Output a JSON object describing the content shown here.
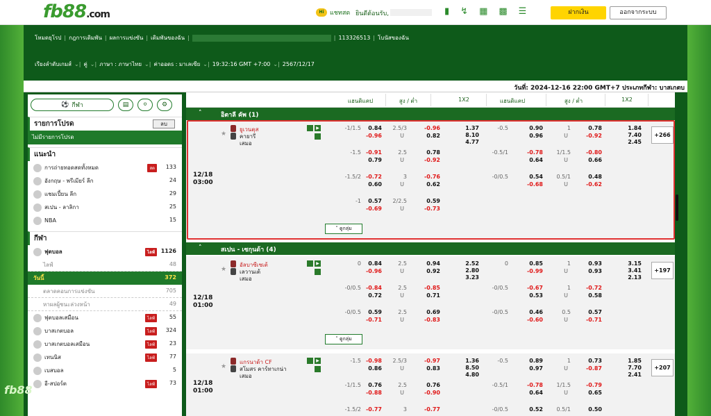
{
  "brand": {
    "logo_main": "fb88",
    "logo_suffix": ".com",
    "watermark": "fb88"
  },
  "topbar": {
    "chat_badge": "Hi",
    "chat_label": "แชทสด",
    "welcome": "ยินดีต้อนรับ,",
    "deposit_label": "ฝากเงิน",
    "logout_label": "ออกจากระบบ"
  },
  "nav1": {
    "items": [
      "โหมดยุโรป",
      "กฎการเดิมพัน",
      "ผลการแข่งขัน",
      "เดิมพันของฉัน"
    ],
    "account_no": "113326513",
    "bonus": "โบนัสของฉัน"
  },
  "nav2": {
    "odds_order": "เรียงลำดับเกมส์",
    "pair": "คู่",
    "language": "ภาษา : ภาษาไทย",
    "odds_type": "ค่าออดs : มาเลเซีย",
    "clock": "19:32:16 GMT +7:00",
    "date": "2567/12/17"
  },
  "datebar": {
    "text": "วันที่: 2024-12-16 22:00 GMT+7 ประเภทกีฬา: บาสเกตบ"
  },
  "sidebar": {
    "sports_pill": "กีฬา",
    "favorites_title": "รายการโปรด",
    "favorites_btn": "ลบ",
    "favorites_empty": "ไม่มีรายการโปรด",
    "recommend_title": "แนะนำ",
    "recommend": [
      {
        "label": "การถ่ายทอดสดทั้งหมด",
        "live": "สด",
        "count": "133"
      },
      {
        "label": "อังกฤษ - พรีเมียร์ ลีก",
        "count": "24"
      },
      {
        "label": "แชมเปี้ยน ลีก",
        "count": "29"
      },
      {
        "label": "สเปน - ลาลิกา",
        "count": "25"
      },
      {
        "label": "NBA",
        "count": "15"
      }
    ],
    "sports_title": "กีฬา",
    "sports": [
      {
        "label": "ฟุตบอล",
        "live": "ไลฟ์",
        "count": "1126",
        "type": "bold"
      },
      {
        "label": "ไลฟ์",
        "count": "48",
        "type": "sub"
      },
      {
        "label": "วันนี้",
        "count": "372",
        "type": "active"
      },
      {
        "label": "ตลาดคอนการแข่งขัน",
        "count": "705",
        "type": "sub"
      },
      {
        "label": "หาผลผู้ชนะล่วงหน้า",
        "count": "49",
        "type": "sub"
      },
      {
        "label": "ฟุตบอลเสมือน",
        "live": "ไลฟ์",
        "count": "55",
        "type": "normal"
      },
      {
        "label": "บาสเกตบอล",
        "live": "ไลฟ์",
        "count": "324",
        "type": "normal"
      },
      {
        "label": "บาสเกตบอลเสมือน",
        "live": "ไลฟ์",
        "count": "23",
        "type": "normal"
      },
      {
        "label": "เทนนิส",
        "live": "ไลฟ์",
        "count": "77",
        "type": "normal"
      },
      {
        "label": "เบสบอล",
        "count": "5",
        "type": "normal"
      },
      {
        "label": "อี-สปอร์ต",
        "live": "ไลฟ์",
        "count": "73",
        "type": "normal"
      }
    ]
  },
  "columns": [
    "แฮนดิแคป",
    "สูง / ต่ำ",
    "1X2",
    "แฮนดิแคป",
    "สูง / ต่ำ",
    "1X2"
  ],
  "leagues": [
    {
      "name": "อิตาลี คัพ (1)"
    },
    {
      "name": "สเปน - เซกุนด้า (4)"
    }
  ],
  "expand_label": "ดูกลุ่ม",
  "matches": [
    {
      "date": "12/18",
      "time": "03:00",
      "home": "ยูเวนตุส",
      "away": "คายารี",
      "draw": "เสมอ",
      "more": "+266",
      "lines": [
        {
          "hdp": "-1/1.5",
          "h1": "0.84",
          "h2": "-0.96",
          "ou": "2.5/3",
          "ou2": "U",
          "o1": "-0.96",
          "o2": "0.82",
          "x1": [
            "1.37",
            "8.10",
            "4.77"
          ],
          "fh": "-0.5",
          "fh1": "0.90",
          "fh2": "0.96",
          "fou": "1",
          "fou2": "U",
          "fo1": "0.78",
          "fo2": "-0.92",
          "fx": [
            "1.84",
            "7.40",
            "2.45"
          ]
        },
        {
          "hdp": "-1.5",
          "h1": "-0.91",
          "h2": "0.79",
          "ou": "2.5",
          "ou2": "U",
          "o1": "0.78",
          "o2": "-0.92",
          "fh": "-0.5/1",
          "fh1": "-0.78",
          "fh2": "0.64",
          "fou": "1/1.5",
          "fou2": "U",
          "fo1": "-0.80",
          "fo2": "0.66"
        },
        {
          "hdp": "-1.5/2",
          "h1": "-0.72",
          "h2": "0.60",
          "ou": "3",
          "ou2": "U",
          "o1": "-0.76",
          "o2": "0.62",
          "fh": "-0/0.5",
          "fh1": "0.54",
          "fh2": "-0.68",
          "fou": "0.5/1",
          "fou2": "U",
          "fo1": "0.48",
          "fo2": "-0.62"
        },
        {
          "hdp": "-1",
          "h1": "0.57",
          "h2": "-0.69",
          "ou": "2/2.5",
          "ou2": "U",
          "o1": "0.59",
          "o2": "-0.73"
        }
      ]
    },
    {
      "date": "12/18",
      "time": "01:00",
      "home": "อัลบาซีเซเต้",
      "away": "เลวานเต้",
      "draw": "เสมอ",
      "more": "+197",
      "lines": [
        {
          "hdp": "0",
          "h1": "0.84",
          "h2": "-0.96",
          "ou": "2.5",
          "ou2": "U",
          "o1": "0.94",
          "o2": "0.92",
          "x1": [
            "2.52",
            "2.80",
            "3.23"
          ],
          "fh": "0",
          "fh1": "0.85",
          "fh2": "-0.99",
          "fou": "1",
          "fou2": "U",
          "fo1": "0.93",
          "fo2": "0.93",
          "fx": [
            "3.15",
            "3.41",
            "2.13"
          ]
        },
        {
          "hdp": "-0/0.5",
          "h1": "-0.84",
          "h2": "0.72",
          "ou": "2.5",
          "ou2": "U",
          "o1": "-0.85",
          "o2": "0.71",
          "fh": "-0/0.5",
          "fh1": "-0.67",
          "fh2": "0.53",
          "fou": "1",
          "fou2": "U",
          "fo1": "-0.72",
          "fo2": "0.58"
        },
        {
          "hdp": "-0/0.5",
          "h1": "0.59",
          "h2": "-0.71",
          "ou": "2.5",
          "ou2": "U",
          "o1": "0.69",
          "o2": "-0.83",
          "fh": "-0/0.5",
          "fh1": "0.46",
          "fh2": "-0.60",
          "fou": "0.5",
          "fou2": "U",
          "fo1": "0.57",
          "fo2": "-0.71"
        }
      ]
    },
    {
      "date": "12/18",
      "time": "01:00",
      "home": "แกรนาด้า CF",
      "away": "สโมสร คาร์ทาเกน่า",
      "draw": "เสมอ",
      "more": "+207",
      "lines": [
        {
          "hdp": "-1.5",
          "h1": "-0.98",
          "h2": "0.86",
          "ou": "2.5/3",
          "ou2": "U",
          "o1": "-0.97",
          "o2": "0.83",
          "x1": [
            "1.36",
            "8.50",
            "4.80"
          ],
          "fh": "-0.5",
          "fh1": "0.89",
          "fh2": "0.97",
          "fou": "1",
          "fou2": "U",
          "fo1": "0.73",
          "fo2": "-0.87",
          "fx": [
            "1.85",
            "7.70",
            "2.41"
          ]
        },
        {
          "hdp": "-1/1.5",
          "h1": "0.76",
          "h2": "-0.88",
          "ou": "2.5",
          "ou2": "U",
          "o1": "0.76",
          "o2": "-0.90",
          "fh": "-0.5/1",
          "fh1": "-0.78",
          "fh2": "0.64",
          "fou": "1/1.5",
          "fou2": "U",
          "fo1": "-0.79",
          "fo2": "0.65"
        },
        {
          "hdp": "-1.5/2",
          "h1": "-0.77",
          "h2": "",
          "ou": "3",
          "ou2": "",
          "o1": "-0.77",
          "o2": "",
          "fh": "-0/0.5",
          "fh1": "0.52",
          "fh2": "",
          "fou": "0.5/1",
          "fou2": "",
          "fo1": "0.50",
          "fo2": ""
        }
      ]
    }
  ]
}
